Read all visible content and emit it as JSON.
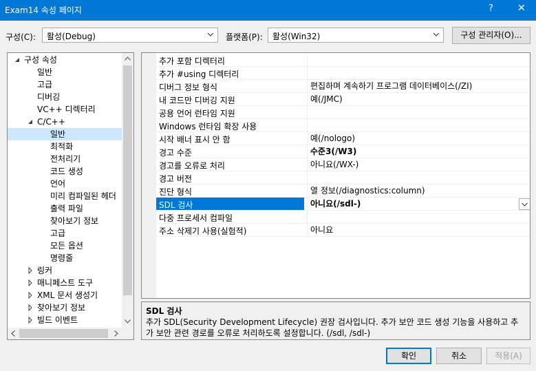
{
  "window": {
    "title": "Exam14 속성 페이지",
    "help_label": "?",
    "close_label": "✕"
  },
  "config_bar": {
    "config_label": "구성(C):",
    "config_value": "활성(Debug)",
    "platform_label": "플랫폼(P):",
    "platform_value": "활성(Win32)",
    "manager_label": "구성 관리자(O)..."
  },
  "tree": {
    "items": [
      {
        "label": "구성 속성",
        "expander": "expanded"
      },
      {
        "label": "일반"
      },
      {
        "label": "고급"
      },
      {
        "label": "디버깅"
      },
      {
        "label": "VC++ 디렉터리"
      },
      {
        "label": "C/C++",
        "expander": "expanded"
      },
      {
        "label": "일반",
        "selected": true
      },
      {
        "label": "최적화"
      },
      {
        "label": "전처리기"
      },
      {
        "label": "코드 생성"
      },
      {
        "label": "언어"
      },
      {
        "label": "미리 컴파일된 헤더"
      },
      {
        "label": "출력 파일"
      },
      {
        "label": "찾아보기 정보"
      },
      {
        "label": "고급"
      },
      {
        "label": "모든 옵션"
      },
      {
        "label": "명령줄"
      },
      {
        "label": "링커",
        "expander": "collapsed"
      },
      {
        "label": "매니페스트 도구",
        "expander": "collapsed"
      },
      {
        "label": "XML 문서 생성기",
        "expander": "collapsed"
      },
      {
        "label": "찾아보기 정보",
        "expander": "collapsed"
      },
      {
        "label": "빌드 이벤트",
        "expander": "collapsed"
      }
    ]
  },
  "properties": [
    {
      "name": "추가 포함 디렉터리",
      "value": ""
    },
    {
      "name": "추가 #using 디렉터리",
      "value": ""
    },
    {
      "name": "디버그 정보 형식",
      "value": "편집하며 계속하기 프로그램 데이터베이스(/ZI)"
    },
    {
      "name": "내 코드만 디버깅 지원",
      "value": "예(/JMC)"
    },
    {
      "name": "공용 언어 런타임 지원",
      "value": ""
    },
    {
      "name": "Windows 런타임 확장 사용",
      "value": ""
    },
    {
      "name": "시작 배너 표시 안 함",
      "value": "예(/nologo)"
    },
    {
      "name": "경고 수준",
      "value": "수준3(/W3)",
      "bold": true
    },
    {
      "name": "경고를 오류로 처리",
      "value": "아니요(/WX-)"
    },
    {
      "name": "경고 버전",
      "value": ""
    },
    {
      "name": "진단 형식",
      "value": "열 정보(/diagnostics:column)"
    },
    {
      "name": "SDL 검사",
      "value": "아니요(/sdl-)",
      "bold": true,
      "selected": true
    },
    {
      "name": "다중 프로세서 컴파일",
      "value": ""
    },
    {
      "name": "주소 삭제기 사용(실험적)",
      "value": "아니요"
    }
  ],
  "description": {
    "title": "SDL 검사",
    "text": "추가 SDL(Security Development Lifecycle) 권장 검사입니다. 추가 보안 코드 생성 기능을 사용하고 추가 보안 관련 경로를 오류로 처리하도록 설정합니다. (/sdl, /sdl-)"
  },
  "buttons": {
    "ok": "확인",
    "cancel": "취소",
    "apply": "적용(A)"
  },
  "colors": {
    "titlebar": "#0078d7",
    "selection": "#0078d7",
    "tree_selection": "#cce8ff"
  }
}
